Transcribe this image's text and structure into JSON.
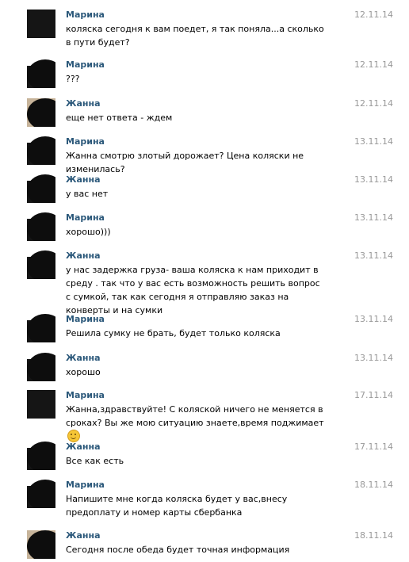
{
  "messages": [
    {
      "author": "Марина",
      "date": "12.11.14",
      "text": "коляска сегодня к вам поедет, я так поняла...а сколько в пути будет?"
    },
    {
      "author": "Марина",
      "date": "12.11.14",
      "text": "???"
    },
    {
      "author": "Жанна",
      "date": "12.11.14",
      "text": "еще нет ответа - ждем"
    },
    {
      "author": "Марина",
      "date": "13.11.14",
      "text": "Жанна смотрю злотый дорожает? Цена коляски не изменилась?"
    },
    {
      "author": "Жанна",
      "date": "13.11.14",
      "text": "у вас нет"
    },
    {
      "author": "Марина",
      "date": "13.11.14",
      "text": "хорошо)))"
    },
    {
      "author": "Жанна",
      "date": "13.11.14",
      "text": "у нас задержка груза- ваша коляска к нам приходит в среду . так что у вас есть возможность решить вопрос с сумкой, так как сегодня я отправляю заказ на конверты и на сумки"
    },
    {
      "author": "Марина",
      "date": "13.11.14",
      "text": "Решила сумку не брать, будет только коляска"
    },
    {
      "author": "Жанна",
      "date": "13.11.14",
      "text": "хорошо"
    },
    {
      "author": "Марина",
      "date": "17.11.14",
      "text": "Жанна,здравствуйте! С коляской ничего не меняется в сроках? Вы же мою ситуацию знаете,время поджимает"
    },
    {
      "author": "Жанна",
      "date": "17.11.14",
      "text": "Все как есть"
    },
    {
      "author": "Марина",
      "date": "18.11.14",
      "text": "Напишите мне когда коляска будет у вас,внесу предоплату и номер карты сбербанка"
    },
    {
      "author": "Жанна",
      "date": "18.11.14",
      "text": "Сегодня после обеда будет точная информация"
    }
  ],
  "icons": {
    "avatar": "blacked-out-avatar",
    "smiley": "smiley-emoji"
  }
}
